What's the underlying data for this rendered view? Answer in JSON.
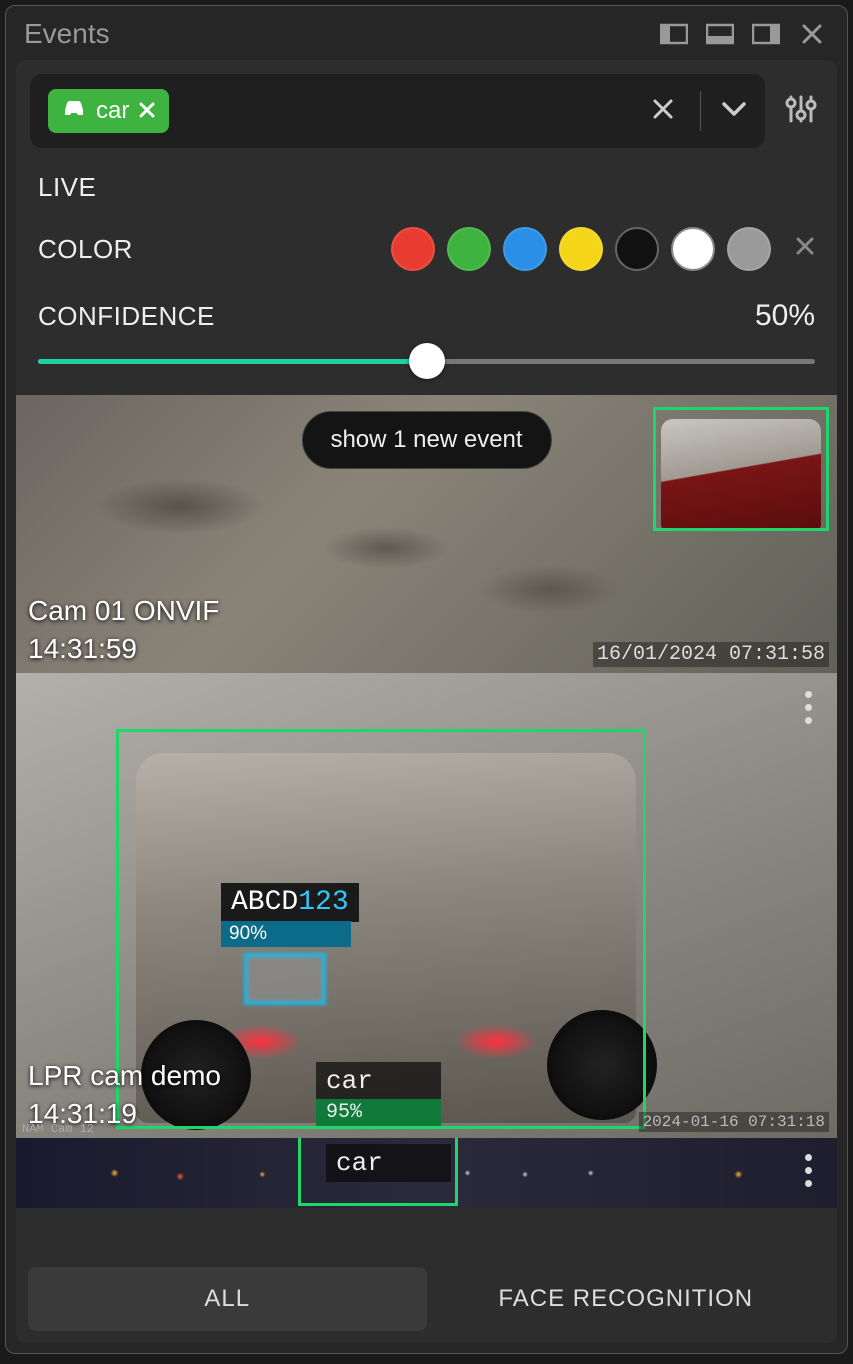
{
  "title": "Events",
  "search": {
    "chip": {
      "icon": "car-icon",
      "label": "car"
    }
  },
  "filters": {
    "live_label": "LIVE",
    "color_label": "COLOR",
    "colors": [
      "#e73c2f",
      "#3fb33f",
      "#2a8fe6",
      "#f4d519",
      "#111111",
      "#ffffff",
      "#9a9a9a"
    ],
    "confidence_label": "CONFIDENCE",
    "confidence_value": "50%",
    "confidence_percent": 50
  },
  "new_events_pill": "show 1 new event",
  "events": [
    {
      "camera": "Cam 01 ONVIF",
      "time": "14:31:59",
      "osd_timestamp": "16/01/2024 07:31:58"
    },
    {
      "camera": "LPR cam demo",
      "time": "14:31:19",
      "osd_timestamp": "2024-01-16 07:31:18",
      "osd_small": "NAM Cam 12",
      "plate_text_alpha": "ABCD",
      "plate_text_num": "123",
      "plate_confidence": "90%",
      "det_label": "car",
      "det_conf": "95%"
    },
    {
      "det_label": "car"
    }
  ],
  "tabs": {
    "all": "ALL",
    "face": "FACE RECOGNITION"
  }
}
